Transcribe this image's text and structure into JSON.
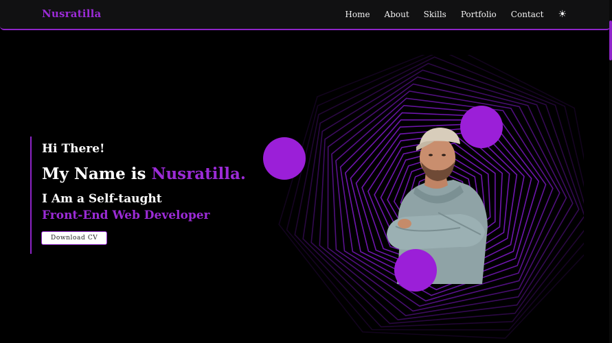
{
  "nav": {
    "brand": "Nusratilla",
    "links": [
      "Home",
      "About",
      "Skills",
      "Portfolio",
      "Contact"
    ],
    "theme_icon": "sun-icon",
    "theme_glyph": "☀"
  },
  "hero": {
    "greeting": "Hi There!",
    "name_prefix": "My Name is ",
    "name_accent": "Nusratilla.",
    "role_line1": "I Am a Self-taught",
    "role_line2": "Front-End Web Developer",
    "cta_label": "Download CV"
  },
  "colors": {
    "accent": "#9b2bd6",
    "background": "#000000",
    "navbar": "#111112"
  }
}
